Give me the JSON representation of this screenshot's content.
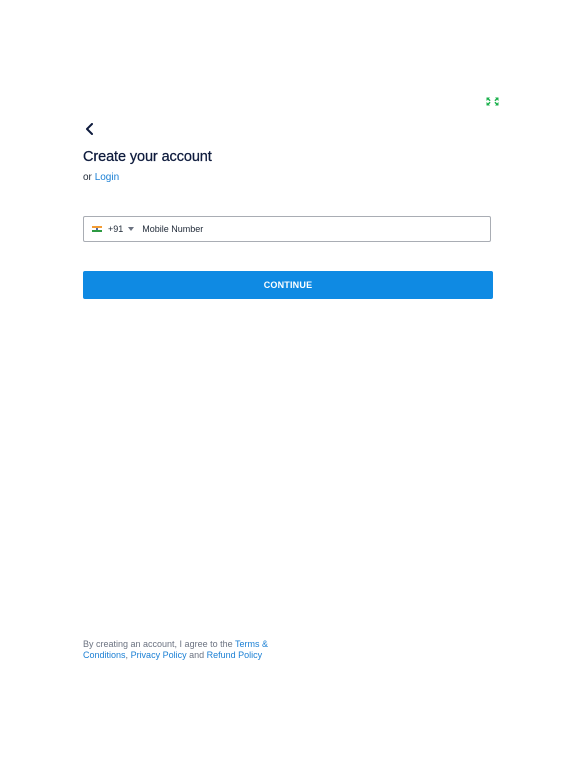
{
  "header": {
    "expand_icon": "expand-arrows-icon",
    "back_icon": "chevron-left-icon"
  },
  "form": {
    "title": "Create your account",
    "or_text": "or",
    "login_link": "Login",
    "country": {
      "flag": "india-flag-icon",
      "dial_code": "+91",
      "dropdown_icon": "caret-down-icon"
    },
    "mobile_placeholder": "Mobile Number",
    "mobile_value": "",
    "continue_label": "CONTINUE"
  },
  "legal": {
    "prefix": "By creating an account, I agree to the",
    "terms_link": "Terms & Conditions",
    "separator": ",",
    "privacy_link": "Privacy Policy",
    "and_text": "and",
    "refund_link": "Refund Policy"
  },
  "colors": {
    "primary": "#0f8ae3",
    "link": "#1a7fd4",
    "title": "#0e1b3d",
    "expand_icon": "#19b04b"
  }
}
